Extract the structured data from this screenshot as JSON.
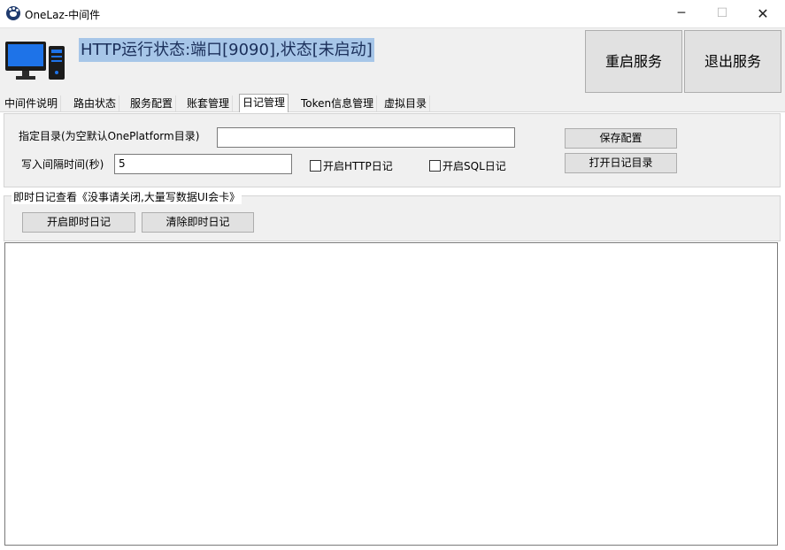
{
  "window": {
    "title": "OneLaz-中间件",
    "minimize": "─",
    "maximize": "☐",
    "close": "✕"
  },
  "header": {
    "status": "HTTP运行状态:端口[9090],状态[未启动]",
    "restart_label": "重启服务",
    "exit_label": "退出服务"
  },
  "tabs": [
    {
      "label": "中间件说明"
    },
    {
      "label": "路由状态"
    },
    {
      "label": "服务配置"
    },
    {
      "label": "账套管理"
    },
    {
      "label": "日记管理",
      "active": true
    },
    {
      "label": "Token信息管理"
    },
    {
      "label": "虚拟目录"
    }
  ],
  "config": {
    "dir_label": "指定目录(为空默认OnePlatform目录)",
    "dir_value": "",
    "interval_label": "写入间隔时间(秒)",
    "interval_value": "5",
    "http_log_label": "开启HTTP日记",
    "http_log_checked": false,
    "sql_log_label": "开启SQL日记",
    "sql_log_checked": false,
    "save_label": "保存配置",
    "open_dir_label": "打开日记目录"
  },
  "realtime": {
    "legend": "即时日记查看《没事请关闭,大量写数据UI会卡》",
    "start_label": "开启即时日记",
    "clear_label": "清除即时日记"
  },
  "colors": {
    "status_highlight": "#a7c6e8",
    "panel_bg": "#f0f0f0",
    "button_bg": "#e1e1e1",
    "monitor_blue": "#1e73e8"
  },
  "icons": {
    "app": "paw-icon",
    "monitor": "computer-monitor-icon"
  }
}
